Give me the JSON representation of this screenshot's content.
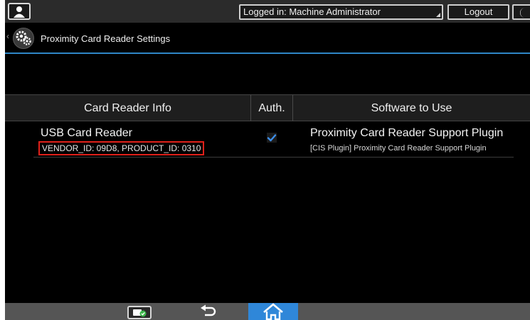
{
  "topbar": {
    "login_label": "Logged in: Machine Administrator",
    "logout_label": "Logout"
  },
  "header": {
    "title": "Proximity Card Reader Settings"
  },
  "table": {
    "headers": {
      "card_reader_info": "Card Reader Info",
      "auth": "Auth.",
      "software": "Software to Use"
    },
    "rows": [
      {
        "reader_name": "USB Card Reader",
        "vendor_product": "VENDOR_ID: 09D8, PRODUCT_ID: 0310",
        "auth_checked": true,
        "software_main": "Proximity Card Reader Support Plugin",
        "software_sub": "[CIS Plugin] Proximity Card Reader Support Plugin"
      }
    ]
  },
  "colors": {
    "accent_blue": "#2f87c7",
    "highlight_red": "#e0201a",
    "check_blue": "#3d8ee8"
  },
  "icons": {
    "user": "user-icon",
    "settings": "gears-icon",
    "moon": "moon-icon",
    "app": "app-check-icon",
    "back": "back-arrow-icon",
    "home": "home-icon"
  }
}
